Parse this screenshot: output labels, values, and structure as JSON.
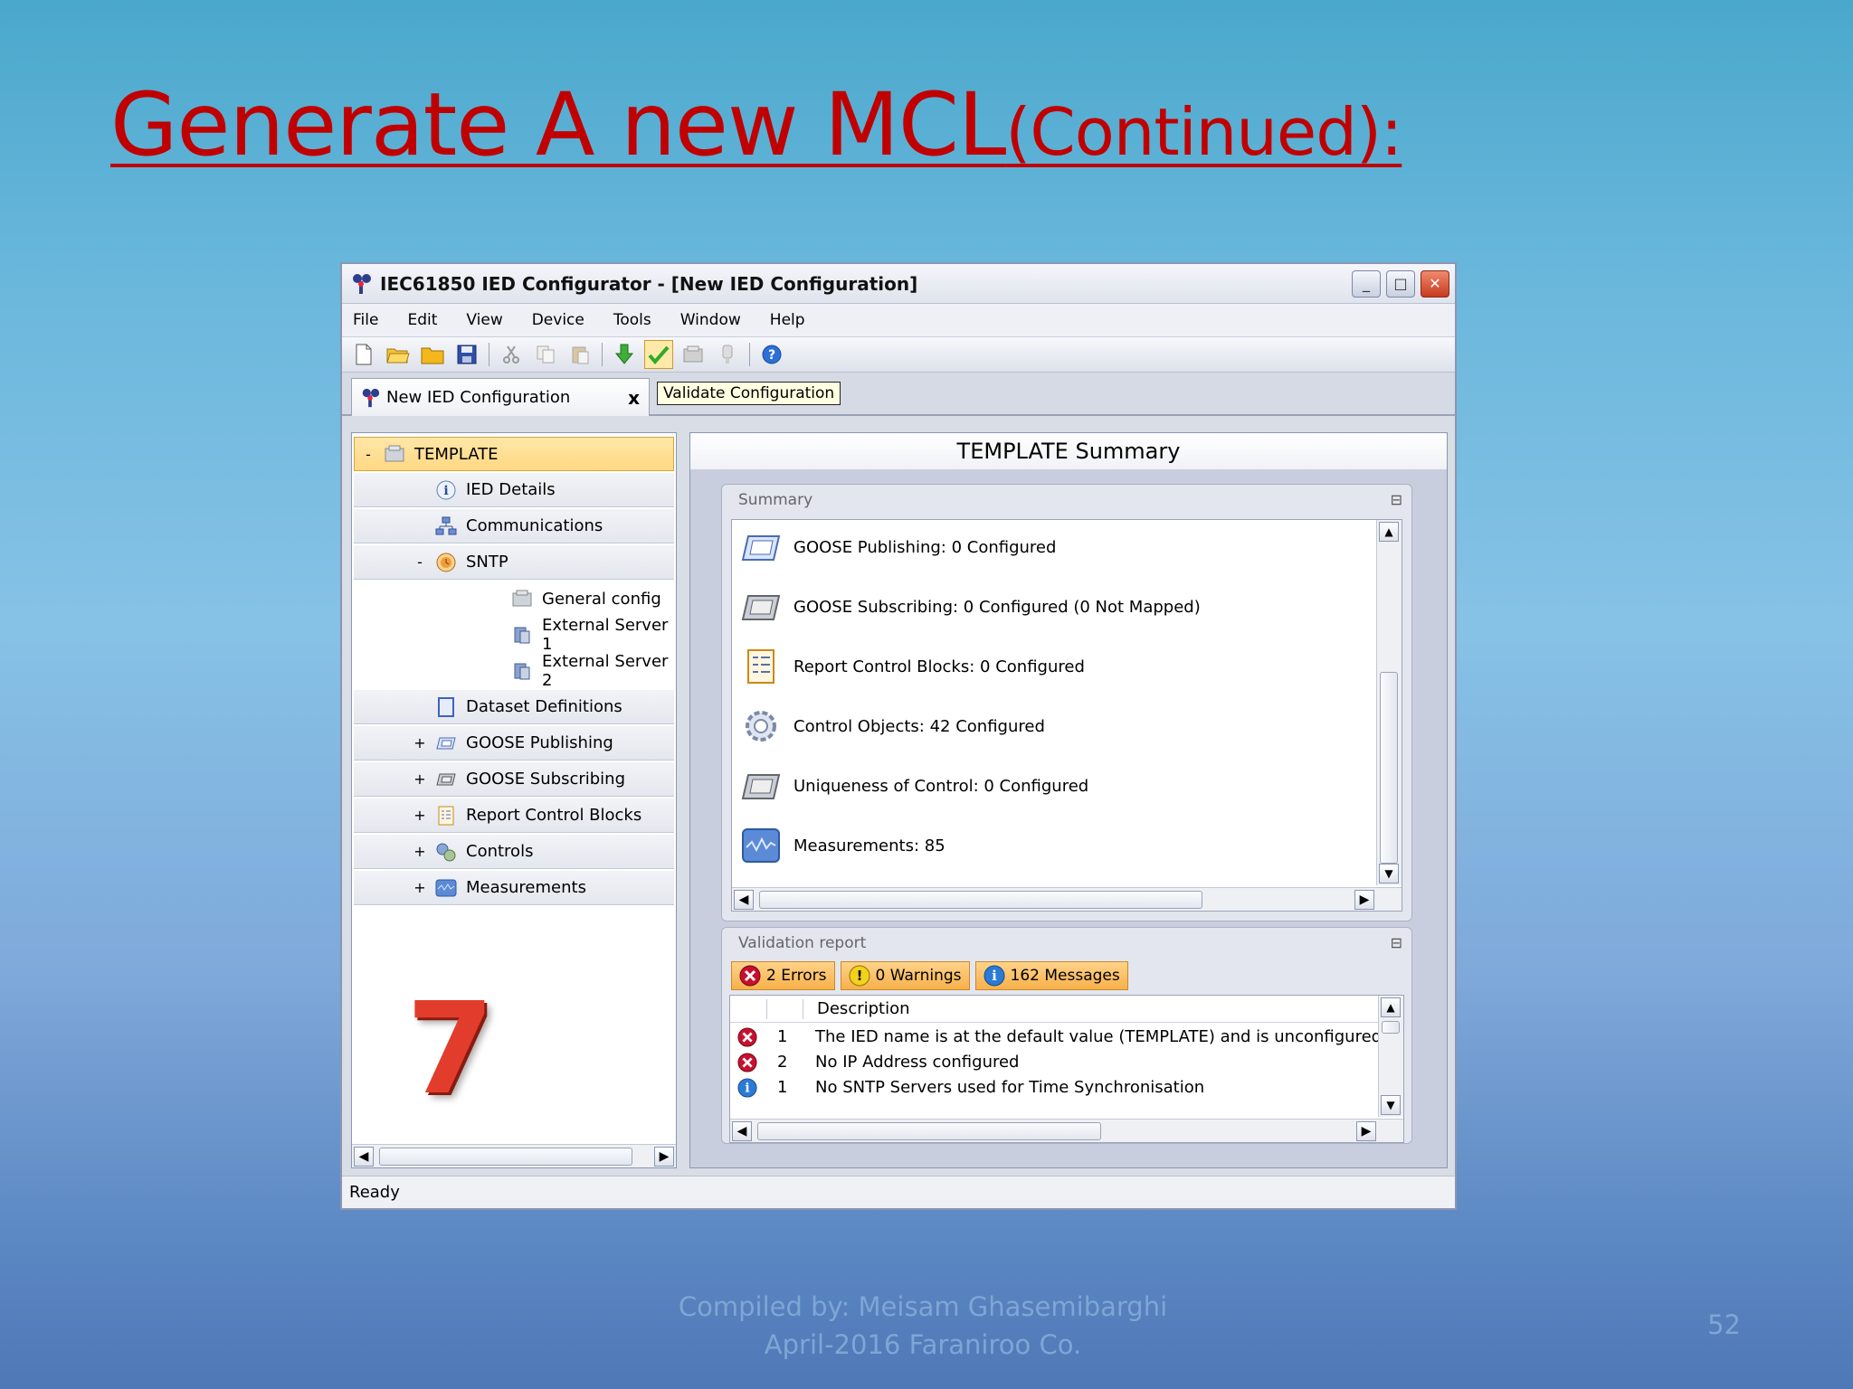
{
  "slide": {
    "title": "Generate A new MCL",
    "title_suffix": "(Continued):",
    "footer_line1": "Compiled by: Meisam Ghasemibarghi",
    "footer_line2": "April-2016 Faraniroo Co.",
    "page_number": "52"
  },
  "window": {
    "title": "IEC61850 IED Configurator - [New IED Configuration]",
    "minimize": "_",
    "maximize": "□",
    "close": "✕"
  },
  "menu": [
    "File",
    "Edit",
    "View",
    "Device",
    "Tools",
    "Window",
    "Help"
  ],
  "tab": {
    "label": "New IED Configuration",
    "close": "x"
  },
  "tooltip": "Validate Configuration",
  "tree": {
    "items": [
      {
        "label": "TEMPLATE",
        "expander": "-",
        "icon": "server-icon"
      },
      {
        "label": "IED Details",
        "expander": "",
        "icon": "info-icon"
      },
      {
        "label": "Communications",
        "expander": "",
        "icon": "network-icon"
      },
      {
        "label": "SNTP",
        "expander": "-",
        "icon": "clock-icon"
      },
      {
        "label": "General config",
        "expander": "",
        "icon": "config-icon"
      },
      {
        "label": "External Server 1",
        "expander": "",
        "icon": "server-small-icon"
      },
      {
        "label": "External Server 2",
        "expander": "",
        "icon": "server-small-icon"
      },
      {
        "label": "Dataset Definitions",
        "expander": "",
        "icon": "dataset-icon"
      },
      {
        "label": "GOOSE Publishing",
        "expander": "+",
        "icon": "goose-pub-icon"
      },
      {
        "label": "GOOSE Subscribing",
        "expander": "+",
        "icon": "goose-sub-icon"
      },
      {
        "label": "Report Control Blocks",
        "expander": "+",
        "icon": "report-icon"
      },
      {
        "label": "Controls",
        "expander": "+",
        "icon": "controls-icon"
      },
      {
        "label": "Measurements",
        "expander": "+",
        "icon": "measurements-icon"
      }
    ],
    "annotation": "7"
  },
  "summary": {
    "title": "TEMPLATE Summary",
    "group_label": "Summary",
    "rows": [
      {
        "text": "GOOSE Publishing: 0 Configured",
        "icon": "goose-pub-icon"
      },
      {
        "text": "GOOSE Subscribing: 0 Configured (0 Not Mapped)",
        "icon": "goose-sub-icon"
      },
      {
        "text": "Report Control Blocks: 0 Configured",
        "icon": "report-icon"
      },
      {
        "text": "Control Objects: 42 Configured",
        "icon": "gear-icon"
      },
      {
        "text": "Uniqueness of Control: 0 Configured",
        "icon": "goose-sub-icon"
      },
      {
        "text": "Measurements: 85",
        "icon": "waveform-icon"
      }
    ]
  },
  "validation": {
    "group_label": "Validation report",
    "errors": "2 Errors",
    "warnings": "0 Warnings",
    "messages": "162 Messages",
    "column_description": "Description",
    "rows": [
      {
        "type": "error",
        "num": "1",
        "desc": "The IED name is at the default value (TEMPLATE) and is unconfigured"
      },
      {
        "type": "error",
        "num": "2",
        "desc": "No IP Address configured"
      },
      {
        "type": "info",
        "num": "1",
        "desc": "No SNTP Servers used for Time Synchronisation"
      }
    ]
  },
  "status": {
    "text": "Ready"
  },
  "colors": {
    "title_red": "#c00000",
    "selection": "#ffd884",
    "error": "#c8102e",
    "info": "#2a7bd6",
    "warning": "#f2d21b"
  }
}
